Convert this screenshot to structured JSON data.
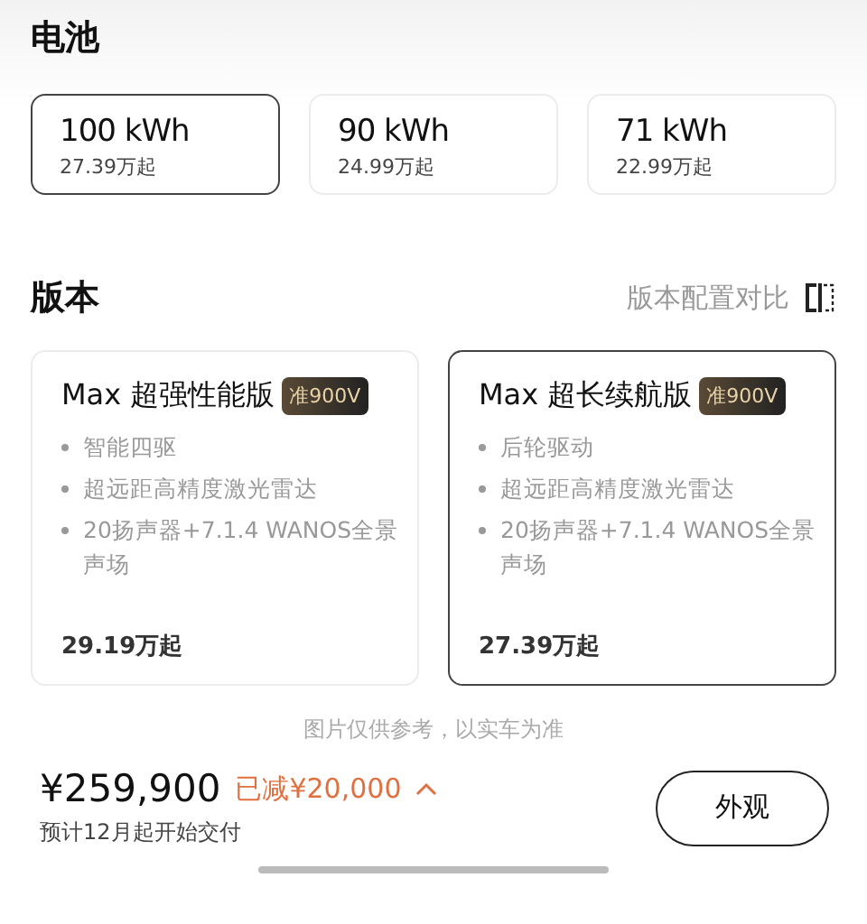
{
  "battery": {
    "title": "电池",
    "options": [
      {
        "capacity": "100 kWh",
        "price": "27.39万起",
        "selected": true
      },
      {
        "capacity": "90 kWh",
        "price": "24.99万起",
        "selected": false
      },
      {
        "capacity": "71 kWh",
        "price": "22.99万起",
        "selected": false
      }
    ]
  },
  "version": {
    "title": "版本",
    "compare_link": "版本配置对比",
    "options": [
      {
        "name": "Max 超强性能版",
        "badge": "准900V",
        "features": [
          "智能四驱",
          "超远距高精度激光雷达",
          "20扬声器+7.1.4 WANOS全景声场"
        ],
        "price": "29.19万起",
        "selected": false
      },
      {
        "name": "Max 超长续航版",
        "badge": "准900V",
        "features": [
          "后轮驱动",
          "超远距高精度激光雷达",
          "20扬声器+7.1.4 WANOS全景声场"
        ],
        "price": "27.39万起",
        "selected": true
      }
    ]
  },
  "disclaimer": "图片仅供参考，以实车为准",
  "footer": {
    "price": "¥259,900",
    "discount": "已减¥20,000",
    "delivery": "预计12月起开始交付",
    "button": "外观"
  }
}
